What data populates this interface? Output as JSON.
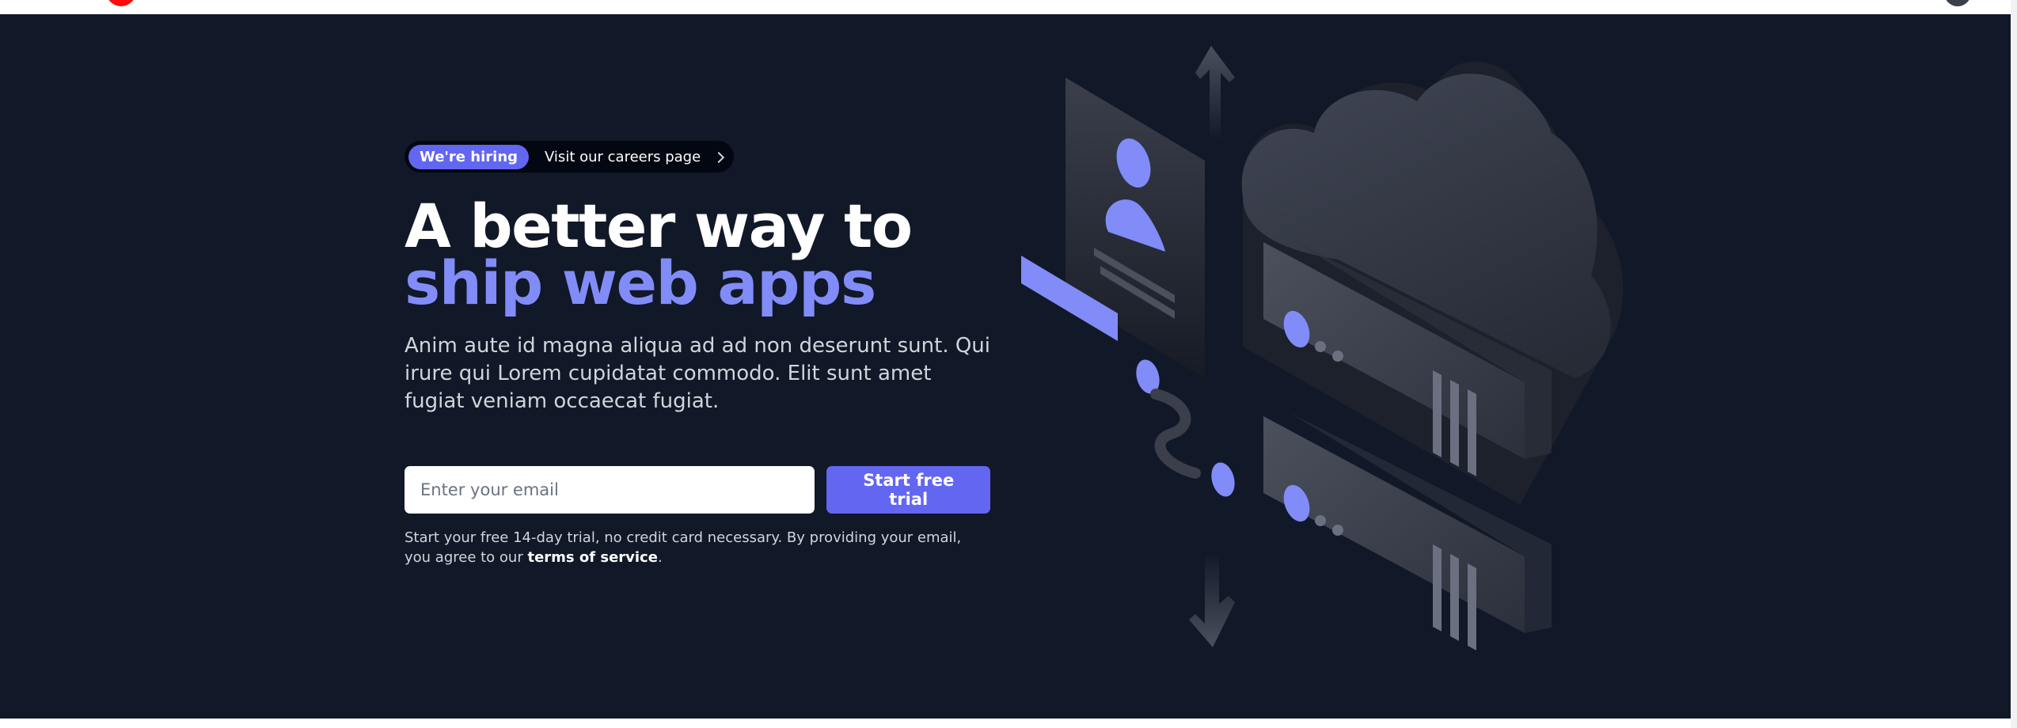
{
  "badge": {
    "pill": "We're hiring",
    "link": "Visit our careers page"
  },
  "headline": {
    "line1": "A better way to",
    "line2": "ship web apps"
  },
  "lead": "Anim aute id magna aliqua ad ad non deserunt sunt. Qui irure qui Lorem cupidatat commodo. Elit sunt amet fugiat veniam occaecat fugiat.",
  "form": {
    "email_placeholder": "Enter your email",
    "cta_label": "Start free trial"
  },
  "fineprint": {
    "before": "Start your free 14-day trial, no credit card necessary. By providing your email, you agree to our ",
    "link": "terms of service",
    "after": "."
  },
  "colors": {
    "background": "#111827",
    "accent": "#6366f1",
    "accent_text": "#818cf8",
    "brand_red": "#ff0a0a"
  },
  "icons": [
    "chevron-right-icon",
    "cloud-servers-illustration",
    "profile-card-icon",
    "arrow-up-icon",
    "arrow-down-icon"
  ]
}
